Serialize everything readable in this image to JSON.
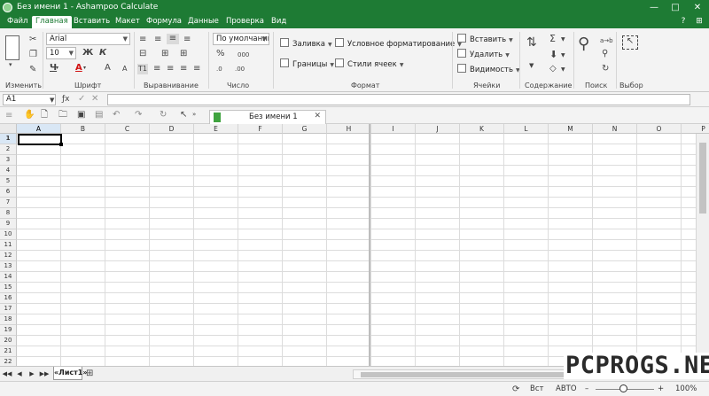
{
  "window": {
    "title": "Без имени 1 - Ashampoo Calculate",
    "controls": {
      "minimize": "—",
      "maximize": "□",
      "close": "✕"
    }
  },
  "menu": {
    "items": [
      "Файл",
      "Главная",
      "Вставить",
      "Макет",
      "Формула",
      "Данные",
      "Проверка",
      "Вид"
    ],
    "active": "Главная",
    "help_icons": [
      "?",
      "⊞"
    ]
  },
  "ribbon": {
    "groups": {
      "edit": "Изменить",
      "font": "Шрифт",
      "align": "Выравнивание",
      "number": "Число",
      "format": "Формат",
      "cells": "Ячейки",
      "content": "Содержание",
      "search": "Поиск",
      "select": "Выбор"
    },
    "font_name": "Arial",
    "font_size": "10",
    "bold": "Ж",
    "italic": "К",
    "underline": "Ч",
    "font_color": "А",
    "grow_font": "A",
    "shrink_font": "A",
    "number_format": "По умолчанию",
    "percent": "%",
    "thousands": "000",
    "decimal_add": ".0",
    "decimal_remove": ".00",
    "fill": "Заливка",
    "conditional_format": "Условное форматирование",
    "borders": "Границы",
    "cell_styles": "Стили ячеек",
    "insert": "Вставить",
    "delete": "Удалить",
    "visibility": "Видимость",
    "sum": "Σ",
    "replace": "a→b",
    "accent_color": "#1e7b34"
  },
  "formula_bar": {
    "name_box": "A1",
    "fx": "ƒx",
    "formula": ""
  },
  "document_tab": {
    "title": "Без имени 1"
  },
  "sheet": {
    "columns": [
      "A",
      "B",
      "C",
      "D",
      "E",
      "F",
      "G",
      "H",
      "I",
      "J",
      "K",
      "L",
      "M",
      "N",
      "O",
      "P"
    ],
    "rows": [
      "1",
      "2",
      "3",
      "4",
      "5",
      "6",
      "7",
      "8",
      "9",
      "10",
      "11",
      "12",
      "13",
      "14",
      "15",
      "16",
      "17",
      "18",
      "19",
      "20",
      "21",
      "22"
    ],
    "active_cell": "A1"
  },
  "sheet_tabs": {
    "tabs": [
      "«Лист1»"
    ],
    "nav": [
      "◀◀",
      "◀",
      "▶",
      "▶▶"
    ]
  },
  "status_bar": {
    "insert_mode": "Вст",
    "calc_mode": "АВТО",
    "zoom_minus": "–",
    "zoom_plus": "+",
    "zoom_level": "100%"
  },
  "watermark": "PCPROGS.NET"
}
